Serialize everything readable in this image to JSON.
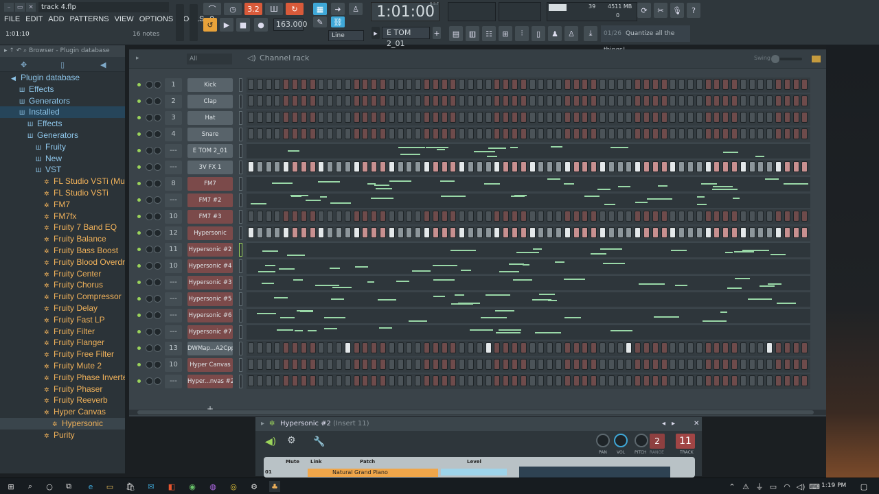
{
  "title": "track 4.flp",
  "menus": [
    "FILE",
    "EDIT",
    "ADD",
    "PATTERNS",
    "VIEW",
    "OPTIONS",
    "TOOLS",
    "?"
  ],
  "time_position": "1:01:10",
  "notes_count": "16 notes",
  "transport": {
    "tempo": "163.000",
    "time": "1:01:00",
    "bst": "B:S:T",
    "snap": "Line",
    "pattern": "E TOM 2_01"
  },
  "monitor": {
    "cpu": "39",
    "memory": "4511 MB",
    "polyphony": "0"
  },
  "hint": {
    "count": "01/26",
    "text": "Quantize all the things!"
  },
  "browser": {
    "header": "Browser - Plugin database",
    "items": [
      {
        "label": "Plugin database",
        "level": 0,
        "color": "blue",
        "icon": "plug-icon"
      },
      {
        "label": "Effects",
        "level": 1,
        "color": "blue",
        "icon": "effects-icon"
      },
      {
        "label": "Generators",
        "level": 1,
        "color": "blue",
        "icon": "generators-icon"
      },
      {
        "label": "Installed",
        "level": 1,
        "color": "blue",
        "icon": "installed-icon"
      },
      {
        "label": "Effects",
        "level": 2,
        "color": "blue",
        "icon": "effects-icon"
      },
      {
        "label": "Generators",
        "level": 2,
        "color": "blue",
        "icon": "generators-icon"
      },
      {
        "label": "Fruity",
        "level": 3,
        "color": "blue",
        "icon": "folder-icon"
      },
      {
        "label": "New",
        "level": 3,
        "color": "blue",
        "icon": "folder-icon"
      },
      {
        "label": "VST",
        "level": 3,
        "color": "blue",
        "icon": "folder-icon"
      },
      {
        "label": "FL Studio VSTi (Multi)",
        "level": 4,
        "color": "orange",
        "icon": "gear-icon"
      },
      {
        "label": "FL Studio VSTi",
        "level": 4,
        "color": "orange",
        "icon": "gear-icon"
      },
      {
        "label": "FM7",
        "level": 4,
        "color": "orange",
        "icon": "gear-icon"
      },
      {
        "label": "FM7fx",
        "level": 4,
        "color": "orange",
        "icon": "gear-icon"
      },
      {
        "label": "Fruity 7 Band EQ",
        "level": 4,
        "color": "orange",
        "icon": "gear-icon"
      },
      {
        "label": "Fruity Balance",
        "level": 4,
        "color": "orange",
        "icon": "gear-icon"
      },
      {
        "label": "Fruity Bass Boost",
        "level": 4,
        "color": "orange",
        "icon": "gear-icon"
      },
      {
        "label": "Fruity Blood Overdrive",
        "level": 4,
        "color": "orange",
        "icon": "gear-icon"
      },
      {
        "label": "Fruity Center",
        "level": 4,
        "color": "orange",
        "icon": "gear-icon"
      },
      {
        "label": "Fruity Chorus",
        "level": 4,
        "color": "orange",
        "icon": "gear-icon"
      },
      {
        "label": "Fruity Compressor",
        "level": 4,
        "color": "orange",
        "icon": "gear-icon"
      },
      {
        "label": "Fruity Delay",
        "level": 4,
        "color": "orange",
        "icon": "gear-icon"
      },
      {
        "label": "Fruity Fast LP",
        "level": 4,
        "color": "orange",
        "icon": "gear-icon"
      },
      {
        "label": "Fruity Filter",
        "level": 4,
        "color": "orange",
        "icon": "gear-icon"
      },
      {
        "label": "Fruity Flanger",
        "level": 4,
        "color": "orange",
        "icon": "gear-icon"
      },
      {
        "label": "Fruity Free Filter",
        "level": 4,
        "color": "orange",
        "icon": "gear-icon"
      },
      {
        "label": "Fruity Mute 2",
        "level": 4,
        "color": "orange",
        "icon": "gear-icon"
      },
      {
        "label": "Fruity Phase Inverter",
        "level": 4,
        "color": "orange",
        "icon": "gear-icon"
      },
      {
        "label": "Fruity Phaser",
        "level": 4,
        "color": "orange",
        "icon": "gear-icon"
      },
      {
        "label": "Fruity Reeverb",
        "level": 4,
        "color": "orange",
        "icon": "gear-icon"
      },
      {
        "label": "Hyper Canvas",
        "level": 4,
        "color": "orange",
        "icon": "gear-icon"
      },
      {
        "label": "Hypersonic",
        "level": 5,
        "color": "orange",
        "icon": "gear-icon"
      },
      {
        "label": "Purity",
        "level": 4,
        "color": "orange",
        "icon": "gear-icon"
      }
    ]
  },
  "channel_rack": {
    "title": "Channel rack",
    "filter": "All",
    "swing_label": "Swing",
    "channels": [
      {
        "num": "1",
        "name": "Kick",
        "kind": "steps",
        "color": "gray"
      },
      {
        "num": "2",
        "name": "Clap",
        "kind": "steps",
        "color": "gray"
      },
      {
        "num": "3",
        "name": "Hat",
        "kind": "steps",
        "color": "gray"
      },
      {
        "num": "4",
        "name": "Snare",
        "kind": "steps",
        "color": "gray"
      },
      {
        "num": "---",
        "name": "E TOM 2_01",
        "kind": "piano",
        "color": "gray"
      },
      {
        "num": "---",
        "name": "3V FX 1",
        "kind": "steps",
        "color": "gray"
      },
      {
        "num": "8",
        "name": "FM7",
        "kind": "piano",
        "color": "red"
      },
      {
        "num": "---",
        "name": "FM7 #2",
        "kind": "piano",
        "color": "red"
      },
      {
        "num": "10",
        "name": "FM7 #3",
        "kind": "steps",
        "color": "red"
      },
      {
        "num": "12",
        "name": "Hypersonic",
        "kind": "steps",
        "color": "red"
      },
      {
        "num": "11",
        "name": "Hypersonic #2",
        "kind": "piano",
        "color": "red"
      },
      {
        "num": "10",
        "name": "Hypersonic #4",
        "kind": "piano",
        "color": "red"
      },
      {
        "num": "---",
        "name": "Hypersonic #3",
        "kind": "piano",
        "color": "red"
      },
      {
        "num": "---",
        "name": "Hypersonic #5",
        "kind": "piano",
        "color": "red"
      },
      {
        "num": "---",
        "name": "Hypersonic #6",
        "kind": "piano",
        "color": "red"
      },
      {
        "num": "---",
        "name": "Hypersonic #7",
        "kind": "piano",
        "color": "red"
      },
      {
        "num": "13",
        "name": "DWMap...A2Cpp6",
        "kind": "steps",
        "color": "gray"
      },
      {
        "num": "10",
        "name": "Hyper Canvas",
        "kind": "steps",
        "color": "red"
      },
      {
        "num": "---",
        "name": "Hyper...nvas #2",
        "kind": "steps",
        "color": "red"
      }
    ]
  },
  "instrument": {
    "title": "Hypersonic #2",
    "insert": "(Insert 11)",
    "labels": {
      "pan": "PAN",
      "vol": "VOL",
      "pitch": "PITCH",
      "range": "RANGE",
      "track": "TRACK"
    },
    "pitch_range": "2",
    "track": "11",
    "plugin": {
      "mute": "Mute",
      "link": "Link",
      "patch": "Patch",
      "level": "Level",
      "patch_value": "Natural Grand Piano",
      "row_num": "01"
    }
  },
  "taskbar": {
    "time": "1:19 PM"
  },
  "colors": {
    "accent": "#3fa8d8",
    "orange": "#f1b25a",
    "note": "#9ad9a8",
    "red": "#7b4a4a"
  }
}
